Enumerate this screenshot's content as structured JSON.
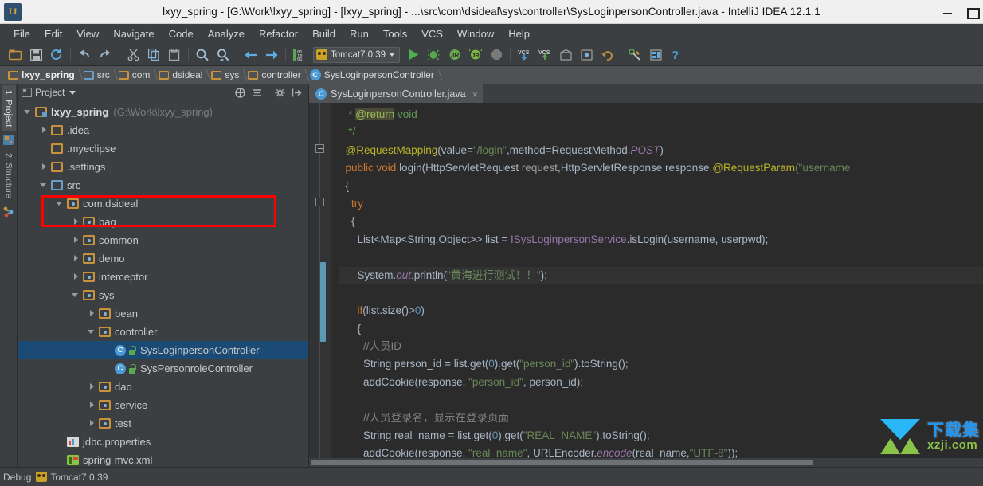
{
  "window": {
    "title": "lxyy_spring - [G:\\Work\\lxyy_spring] - [lxyy_spring] - ...\\src\\com\\dsideal\\sys\\controller\\SysLoginpersonController.java - IntelliJ IDEA 12.1.1",
    "app_icon": "IJ",
    "minimize_label": "–",
    "maximize_label": "□"
  },
  "menubar": {
    "items": [
      {
        "label": "File"
      },
      {
        "label": "Edit"
      },
      {
        "label": "View"
      },
      {
        "label": "Navigate"
      },
      {
        "label": "Code"
      },
      {
        "label": "Analyze"
      },
      {
        "label": "Refactor"
      },
      {
        "label": "Build"
      },
      {
        "label": "Run"
      },
      {
        "label": "Tools"
      },
      {
        "label": "VCS"
      },
      {
        "label": "Window"
      },
      {
        "label": "Help"
      }
    ]
  },
  "toolbar": {
    "run_config": "Tomcat7.0.39",
    "icons": [
      "open-folder-icon",
      "save-all-icon",
      "sync-refresh-icon",
      "undo-icon",
      "redo-icon",
      "cut-icon",
      "copy-icon",
      "paste-icon",
      "find-icon",
      "find-replace-icon",
      "back-icon",
      "forward-icon",
      "toggle-binary-icon"
    ],
    "right_icons": [
      "run-icon",
      "debug-icon",
      "run-with-coverage-icon",
      "rerun-jrebel-icon",
      "stop-icon",
      "vcs-update-icon",
      "vcs-commit-icon",
      "history-icon",
      "rollback-icon",
      "revert-icon",
      "settings-structure-icon",
      "project-structure-icon",
      "help-icon"
    ]
  },
  "breadcrumb": {
    "items": [
      {
        "label": "lxyy_spring",
        "icon": "module-icon",
        "bold": true
      },
      {
        "label": "src",
        "icon": "source-folder-icon",
        "bold": false
      },
      {
        "label": "com",
        "icon": "package-icon",
        "bold": false
      },
      {
        "label": "dsideal",
        "icon": "package-icon",
        "bold": false
      },
      {
        "label": "sys",
        "icon": "package-icon",
        "bold": false
      },
      {
        "label": "controller",
        "icon": "package-icon",
        "bold": false
      },
      {
        "label": "SysLoginpersonController",
        "icon": "class-icon",
        "bold": false
      }
    ]
  },
  "tool_tabs": {
    "left": [
      {
        "label": "1: Project",
        "active": true
      },
      {
        "label": "2: Structure",
        "active": false
      }
    ]
  },
  "project_panel": {
    "title": "Project",
    "header_icons": [
      "scroll-from-source-icon",
      "collapse-all-icon",
      "gear-icon",
      "hide-icon"
    ],
    "tree": [
      {
        "indent": 0,
        "arrow": "down",
        "icon": "module-icon",
        "label": "lxyy_spring",
        "bold": true,
        "suffix": "(G:\\Work\\lxyy_spring)",
        "selected": false
      },
      {
        "indent": 1,
        "arrow": "right",
        "icon": "folder-icon",
        "label": ".idea",
        "bold": false,
        "suffix": "",
        "selected": false
      },
      {
        "indent": 1,
        "arrow": "none",
        "icon": "folder-icon",
        "label": ".myeclipse",
        "bold": false,
        "suffix": "",
        "selected": false
      },
      {
        "indent": 1,
        "arrow": "right",
        "icon": "folder-icon",
        "label": ".settings",
        "bold": false,
        "suffix": "",
        "selected": false
      },
      {
        "indent": 1,
        "arrow": "down",
        "icon": "source-folder-icon",
        "label": "src",
        "bold": false,
        "suffix": "",
        "selected": false
      },
      {
        "indent": 2,
        "arrow": "down",
        "icon": "package-icon",
        "label": "com.dsideal",
        "bold": false,
        "suffix": "",
        "selected": false
      },
      {
        "indent": 3,
        "arrow": "right",
        "icon": "package-icon",
        "label": "bag",
        "bold": false,
        "suffix": "",
        "selected": false
      },
      {
        "indent": 3,
        "arrow": "right",
        "icon": "package-icon",
        "label": "common",
        "bold": false,
        "suffix": "",
        "selected": false
      },
      {
        "indent": 3,
        "arrow": "right",
        "icon": "package-icon",
        "label": "demo",
        "bold": false,
        "suffix": "",
        "selected": false
      },
      {
        "indent": 3,
        "arrow": "right",
        "icon": "package-icon",
        "label": "interceptor",
        "bold": false,
        "suffix": "",
        "selected": false
      },
      {
        "indent": 3,
        "arrow": "down",
        "icon": "package-icon",
        "label": "sys",
        "bold": false,
        "suffix": "",
        "selected": false
      },
      {
        "indent": 4,
        "arrow": "right",
        "icon": "package-icon",
        "label": "bean",
        "bold": false,
        "suffix": "",
        "selected": false
      },
      {
        "indent": 4,
        "arrow": "down",
        "icon": "package-icon",
        "label": "controller",
        "bold": false,
        "suffix": "",
        "selected": false
      },
      {
        "indent": 5,
        "arrow": "none",
        "icon": "class-icon",
        "label": "SysLoginpersonController",
        "bold": false,
        "suffix": "",
        "selected": true
      },
      {
        "indent": 5,
        "arrow": "none",
        "icon": "class-icon",
        "label": "SysPersonroleController",
        "bold": false,
        "suffix": "",
        "selected": false
      },
      {
        "indent": 4,
        "arrow": "right",
        "icon": "package-icon",
        "label": "dao",
        "bold": false,
        "suffix": "",
        "selected": false
      },
      {
        "indent": 4,
        "arrow": "right",
        "icon": "package-icon",
        "label": "service",
        "bold": false,
        "suffix": "",
        "selected": false
      },
      {
        "indent": 4,
        "arrow": "right",
        "icon": "package-icon",
        "label": "test",
        "bold": false,
        "suffix": "",
        "selected": false
      },
      {
        "indent": 2,
        "arrow": "none",
        "icon": "properties-icon",
        "label": "jdbc.properties",
        "bold": false,
        "suffix": "",
        "selected": false
      },
      {
        "indent": 2,
        "arrow": "none",
        "icon": "xml-icon",
        "label": "spring-mvc.xml",
        "bold": false,
        "suffix": "",
        "selected": false
      }
    ]
  },
  "annotation": {
    "type": "red-rectangle-highlight",
    "color": "#ff0000"
  },
  "editor": {
    "tabs": [
      {
        "label": "SysLoginpersonController.java",
        "icon": "class-icon",
        "close_label": "×",
        "active": true
      }
    ],
    "code_lines": [
      {
        "highlight": false,
        "tokens": [
          {
            "t": "   ",
            "c": ""
          },
          {
            "t": "* ",
            "c": "jdt"
          },
          {
            "t": "@return",
            "c": "jdtag"
          },
          {
            "t": " void",
            "c": "jdt"
          }
        ]
      },
      {
        "highlight": false,
        "tokens": [
          {
            "t": "   ",
            "c": ""
          },
          {
            "t": "*/",
            "c": "jdt"
          }
        ]
      },
      {
        "highlight": false,
        "tokens": [
          {
            "t": "  ",
            "c": ""
          },
          {
            "t": "@RequestMapping",
            "c": "ann"
          },
          {
            "t": "(value=",
            "c": "cls2"
          },
          {
            "t": "\"/login\"",
            "c": "str"
          },
          {
            "t": ",method=RequestMethod.",
            "c": "cls2"
          },
          {
            "t": "POST",
            "c": "stat"
          },
          {
            "t": ")",
            "c": "cls2"
          }
        ]
      },
      {
        "highlight": false,
        "tokens": [
          {
            "t": "  ",
            "c": ""
          },
          {
            "t": "public void ",
            "c": "kw"
          },
          {
            "t": "login",
            "c": "cls2"
          },
          {
            "t": "(HttpServletRequest ",
            "c": "cls2"
          },
          {
            "t": "request",
            "c": "pm"
          },
          {
            "t": ",HttpServletResponse response,",
            "c": "cls2"
          },
          {
            "t": "@RequestParam",
            "c": "ann"
          },
          {
            "t": "(\"username",
            "c": "str"
          }
        ]
      },
      {
        "highlight": false,
        "tokens": [
          {
            "t": "  {",
            "c": "cls2"
          }
        ]
      },
      {
        "highlight": false,
        "tokens": [
          {
            "t": "    ",
            "c": ""
          },
          {
            "t": "try",
            "c": "kw"
          }
        ]
      },
      {
        "highlight": false,
        "tokens": [
          {
            "t": "    {",
            "c": "cls2"
          }
        ]
      },
      {
        "highlight": false,
        "tokens": [
          {
            "t": "      List<Map<String,Object>> list = ",
            "c": "cls2"
          },
          {
            "t": "ISysLoginpersonService",
            "c": "fld"
          },
          {
            "t": ".isLogin(username, userpwd);",
            "c": "cls2"
          }
        ]
      },
      {
        "highlight": false,
        "tokens": [
          {
            "t": "",
            "c": ""
          }
        ]
      },
      {
        "highlight": true,
        "tokens": [
          {
            "t": "      System.",
            "c": "cls2"
          },
          {
            "t": "out",
            "c": "stat"
          },
          {
            "t": ".println(",
            "c": "cls2"
          },
          {
            "t": "\"黄海进行测试！！\"",
            "c": "str"
          },
          {
            "t": ");",
            "c": "cls2"
          }
        ]
      },
      {
        "highlight": false,
        "tokens": [
          {
            "t": "",
            "c": ""
          }
        ]
      },
      {
        "highlight": false,
        "tokens": [
          {
            "t": "      ",
            "c": ""
          },
          {
            "t": "if",
            "c": "kw"
          },
          {
            "t": "(list.size()>",
            "c": "cls2"
          },
          {
            "t": "0",
            "c": "num"
          },
          {
            "t": ")",
            "c": "cls2"
          }
        ]
      },
      {
        "highlight": false,
        "tokens": [
          {
            "t": "      {",
            "c": "cls2"
          }
        ]
      },
      {
        "highlight": false,
        "tokens": [
          {
            "t": "        ",
            "c": ""
          },
          {
            "t": "//人员ID",
            "c": "cmt"
          }
        ]
      },
      {
        "highlight": false,
        "tokens": [
          {
            "t": "        String person_id = list.get(",
            "c": "cls2"
          },
          {
            "t": "0",
            "c": "num"
          },
          {
            "t": ").get(",
            "c": "cls2"
          },
          {
            "t": "\"person_id\"",
            "c": "str"
          },
          {
            "t": ").toString();",
            "c": "cls2"
          }
        ]
      },
      {
        "highlight": false,
        "tokens": [
          {
            "t": "        addCookie(response, ",
            "c": "cls2"
          },
          {
            "t": "\"person_id\"",
            "c": "str"
          },
          {
            "t": ", person_id);",
            "c": "cls2"
          }
        ]
      },
      {
        "highlight": false,
        "tokens": [
          {
            "t": "",
            "c": ""
          }
        ]
      },
      {
        "highlight": false,
        "tokens": [
          {
            "t": "        ",
            "c": ""
          },
          {
            "t": "//人员登录名，显示在登录页面",
            "c": "cmt"
          }
        ]
      },
      {
        "highlight": false,
        "tokens": [
          {
            "t": "        String real_name = list.get(",
            "c": "cls2"
          },
          {
            "t": "0",
            "c": "num"
          },
          {
            "t": ").get(",
            "c": "cls2"
          },
          {
            "t": "\"REAL_NAME\"",
            "c": "str"
          },
          {
            "t": ").toString();",
            "c": "cls2"
          }
        ]
      },
      {
        "highlight": false,
        "tokens": [
          {
            "t": "        addCookie(response, ",
            "c": "cls2"
          },
          {
            "t": "\"real_name\"",
            "c": "str"
          },
          {
            "t": ", URLEncoder.",
            "c": "cls2"
          },
          {
            "t": "encode",
            "c": "stat"
          },
          {
            "t": "(real_name,",
            "c": "cls2"
          },
          {
            "t": "\"UTF-8\"",
            "c": "str"
          },
          {
            "t": "));",
            "c": "cls2"
          }
        ]
      }
    ]
  },
  "watermark": {
    "cn": "下载集",
    "en": "xzji.com"
  },
  "statusbar": {
    "debug_label": "Debug",
    "server_label": "Tomcat7.0.39"
  }
}
